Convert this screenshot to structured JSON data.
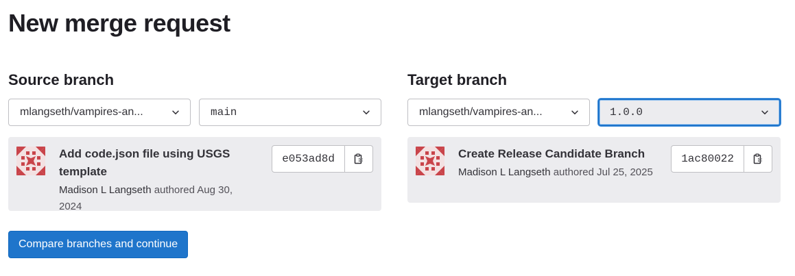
{
  "page": {
    "title": "New merge request"
  },
  "source": {
    "heading": "Source branch",
    "project": "mlangseth/vampires-an...",
    "branch": "main",
    "commit": {
      "title": "Add code.json file using USGS template",
      "author": "Madison L Langseth",
      "authored_text": "authored Aug 30, 2024",
      "sha": "e053ad8d"
    }
  },
  "target": {
    "heading": "Target branch",
    "project": "mlangseth/vampires-an...",
    "branch": "1.0.0",
    "commit": {
      "title": "Create Release Candidate Branch",
      "author": "Madison L Langseth",
      "authored_text": "authored Jul 25, 2025",
      "sha": "1ac80022"
    }
  },
  "actions": {
    "compare_label": "Compare branches and continue"
  },
  "icons": {
    "dropdown": "chevron-down-icon",
    "copy": "copy-to-clipboard-icon",
    "avatar": "identicon-avatar"
  },
  "colors": {
    "primary": "#1f75cb",
    "card_bg": "#ececef",
    "avatar": "#c9444a"
  }
}
